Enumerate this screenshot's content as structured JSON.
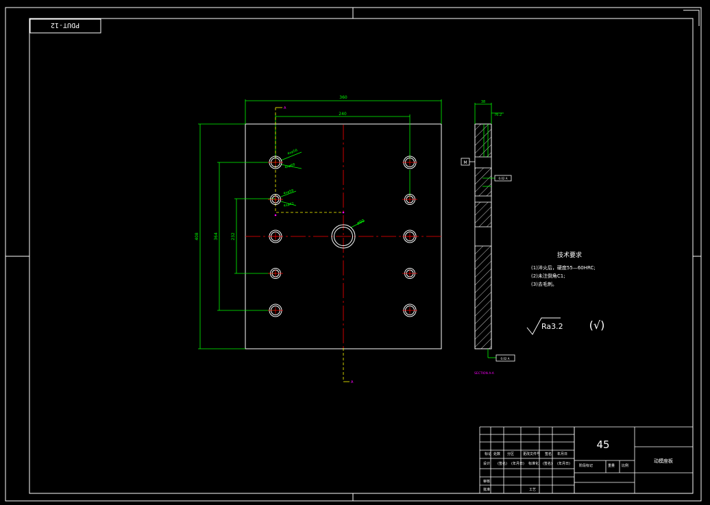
{
  "sheet": {
    "drawing_number": "PDUT-12"
  },
  "front_view": {
    "dim_width": "360",
    "dim_hole_pitch": "240",
    "dim_height": "408",
    "dim_left_outer": "364",
    "dim_left_inner": "232",
    "center_hole_label": "ø90",
    "hole_label_1": "4xø56",
    "hole_label_2": "4xø68",
    "hole_label_3": "4xø58",
    "hole_label_4": "4xø42",
    "section_mark": "A"
  },
  "side_view": {
    "dim_thickness": "38",
    "dim_top": "76.2",
    "datum_a": "M",
    "tolerance_frame_1": "0.02 A",
    "tolerance_frame_2": "0.02 A",
    "section_title": "SECTION A-A"
  },
  "tech_req": {
    "title": "技术要求",
    "items": [
      "(1)淬火后，硬度55—60HRC;",
      "(2)未注倒角C1;",
      "(3)去毛刺。"
    ]
  },
  "roughness": {
    "value": "Ra3.2",
    "other_mark": "(√)"
  },
  "title_block": {
    "material": "45",
    "part_name": "动模座板",
    "row_a": [
      "标记",
      "处数",
      "分区",
      "更改文件号",
      "签名",
      "年月日"
    ],
    "row_b": [
      "设计",
      "(签名)",
      "(年月日)",
      "标准化",
      "(签名)",
      "(年月日)"
    ],
    "stage_label": "阶段标记",
    "weight_label": "重量",
    "scale_label": "比例",
    "check_label": "审核",
    "process_label": "工艺",
    "approve_label": "批准"
  },
  "colors": {
    "frame": "#ffffff",
    "dimension": "#00ff00",
    "center_line": "#ff0000",
    "hidden_line": "#ffff00",
    "section_label": "#ff00ff",
    "background": "#000000"
  }
}
